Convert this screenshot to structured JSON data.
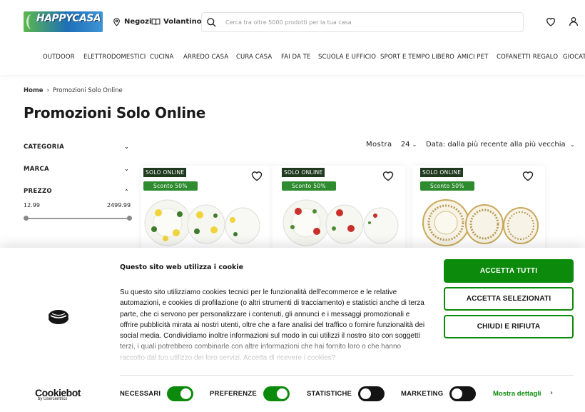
{
  "header": {
    "logo_text": "HAPPYCASA",
    "store_link": "Negozi",
    "flyer_link": "Volantino",
    "search_placeholder": "Cerca tra oltre 5000 prodotti per la tua casa"
  },
  "nav": {
    "items": [
      "OUTDOOR",
      "ELETTRODOMESTICI",
      "CUCINA",
      "ARREDO CASA",
      "CURA CASA",
      "FAI DA TE",
      "SCUOLA E UFFICIO",
      "SPORT E TEMPO LIBERO",
      "AMICI PET",
      "COFANETTI REGALO",
      "GIOCAT"
    ]
  },
  "breadcrumb": {
    "home": "Home",
    "separator": "›",
    "current": "Promozioni Solo Online"
  },
  "page_title": "Promozioni Solo Online",
  "filters": {
    "category": "CATEGORIA",
    "brand": "MARCA",
    "price": "PREZZO",
    "price_min": "12.99",
    "price_max": "2499.99"
  },
  "sort": {
    "show_label": "Mostra",
    "show_value": "24",
    "order_label": "Data: dalla più recente alla più vecchia"
  },
  "products": [
    {
      "badge": "SOLO ONLINE",
      "discount": "Sconto 50%",
      "pattern": "lemon"
    },
    {
      "badge": "SOLO ONLINE",
      "discount": "Sconto 50%",
      "pattern": "apple"
    },
    {
      "badge": "SOLO ONLINE",
      "discount": "Sconto 50%",
      "pattern": "gold"
    }
  ],
  "cookie": {
    "title": "Questo sito web utilizza i cookie",
    "text": "Su questo sito utilizziamo cookies tecnici per le funzionalità dell'ecommerce e le relative automazioni, e cookies di profilazione (o altri strumenti di tracciamento) e statistici anche di terza parte, che ci servono per personalizzare i contenuti, gli annunci e i messaggi promozionali e offrire pubblicità mirata ai nostri utenti, oltre che a fare analisi del traffico o fornire funzionalità dei social media. Condividiamo inoltre informazioni sul modo in cui utilizzi il nostro sito con soggetti terzi, i quali potrebbero combinarle con altre informazioni che hai fornito loro o che hanno raccolto dal tuo utilizzo dei loro servizi. Accetta di ricevere i cookies?",
    "accept_all": "ACCETTA TUTTI",
    "accept_selected": "ACCETTA SELEZIONATI",
    "reject": "CHIUDI E RIFIUTA",
    "brand": "Cookiebot",
    "brand_sub": "by Usercentrics",
    "toggles": [
      {
        "label": "NECESSARI",
        "on": true
      },
      {
        "label": "PREFERENZE",
        "on": true
      },
      {
        "label": "STATISTICHE",
        "on": false
      },
      {
        "label": "MARKETING",
        "on": false
      }
    ],
    "details": "Mostra dettagli",
    "accent_color": "#0c8a0c"
  }
}
